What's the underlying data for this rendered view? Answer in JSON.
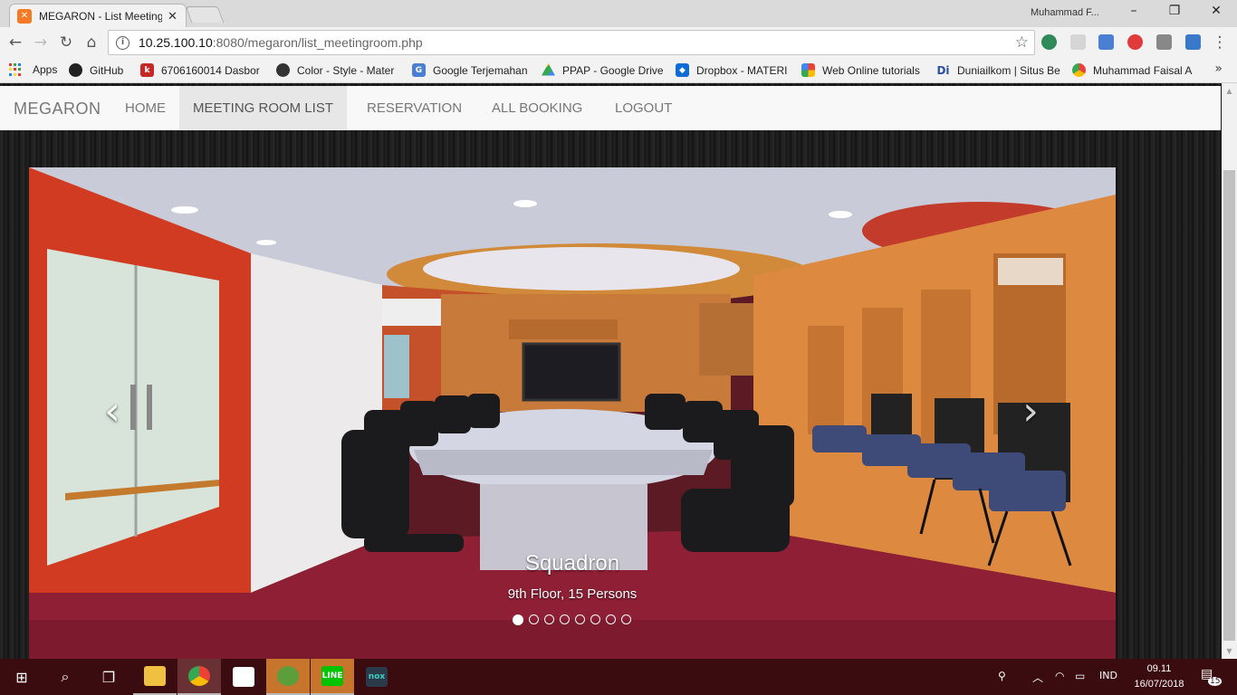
{
  "browser": {
    "tab_title": "MEGARON - List Meeting",
    "user_name": "Muhammad F...",
    "url_host": "10.25.100.10",
    "url_rest": ":8080/megaron/list_meetingroom.php"
  },
  "bookmarks": [
    {
      "label": "Apps"
    },
    {
      "label": "GitHub"
    },
    {
      "label": "6706160014 Dasbor"
    },
    {
      "label": "Color - Style - Mater"
    },
    {
      "label": "Google Terjemahan"
    },
    {
      "label": "PPAP - Google Drive"
    },
    {
      "label": "Dropbox - MATERI"
    },
    {
      "label": "Web Online tutorials"
    },
    {
      "label": "Duniailkom | Situs Be"
    },
    {
      "label": "Muhammad Faisal A"
    }
  ],
  "navbar": {
    "brand": "MEGARON",
    "items": [
      "HOME",
      "MEETING ROOM LIST",
      "RESERVATION",
      "ALL BOOKING",
      "LOGOUT"
    ],
    "active": "MEETING ROOM LIST"
  },
  "carousel": {
    "title": "Squadron",
    "subtitle": "9th Floor, 15 Persons",
    "slide_count": 8,
    "active_slide": 1
  },
  "taskbar": {
    "language": "IND",
    "time": "09.11",
    "date": "16/07/2018",
    "notifications": "15"
  }
}
